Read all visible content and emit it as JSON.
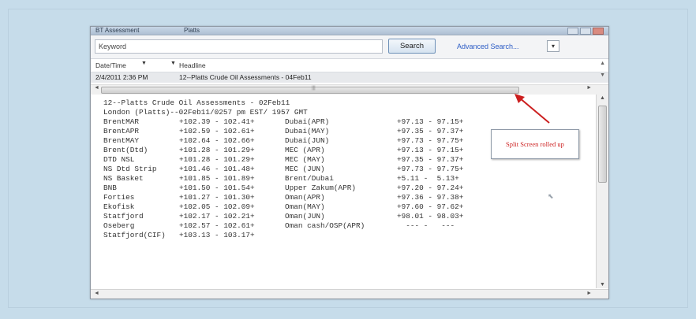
{
  "window": {
    "title_left": "BT Assessment",
    "title_mid": "Platts"
  },
  "search": {
    "keyword_placeholder": "Keyword",
    "search_label": "Search",
    "advanced_label": "Advanced Search...",
    "mini_label": "▾"
  },
  "list": {
    "col_date": "Date/Time",
    "col_headline": "Headline",
    "row_date": "2/4/2011 2:36 PM",
    "row_headline": "12--Platts Crude Oil Assessments - 04Feb11"
  },
  "story": {
    "line1": "12--Platts Crude Oil Assessments - 02Feb11",
    "line2": "London (Platts)--02Feb11/0257 pm EST/ 1957 GMT",
    "rows": [
      {
        "n1": "BrentMAR",
        "v1": "+102.39 - 102.41+",
        "n2": "Dubai(APR)",
        "v2": "+97.13 - 97.15+"
      },
      {
        "n1": "BrentAPR",
        "v1": "+102.59 - 102.61+",
        "n2": "Dubai(MAY)",
        "v2": "+97.35 - 97.37+"
      },
      {
        "n1": "BrentMAY",
        "v1": "+102.64 - 102.66+",
        "n2": "Dubai(JUN)",
        "v2": "+97.73 - 97.75+"
      },
      {
        "n1": "Brent(Dtd)",
        "v1": "+101.28 - 101.29+",
        "n2": "MEC (APR)",
        "v2": "+97.13 - 97.15+"
      },
      {
        "n1": "DTD NSL",
        "v1": "+101.28 - 101.29+",
        "n2": "MEC (MAY)",
        "v2": "+97.35 - 97.37+"
      },
      {
        "n1": "NS Dtd Strip",
        "v1": "+101.46 - 101.48+",
        "n2": "MEC (JUN)",
        "v2": "+97.73 - 97.75+"
      },
      {
        "n1": "NS Basket",
        "v1": "+101.85 - 101.89+",
        "n2": "Brent/Dubai",
        "v2": "+5.11 -  5.13+"
      },
      {
        "n1": "BNB",
        "v1": "+101.50 - 101.54+",
        "n2": "Upper Zakum(APR)",
        "v2": "+97.20 - 97.24+"
      },
      {
        "n1": "Forties",
        "v1": "+101.27 - 101.30+",
        "n2": "Oman(APR)",
        "v2": "+97.36 - 97.38+"
      },
      {
        "n1": "Ekofisk",
        "v1": "+102.05 - 102.09+",
        "n2": "Oman(MAY)",
        "v2": "+97.60 - 97.62+"
      },
      {
        "n1": "Statfjord",
        "v1": "+102.17 - 102.21+",
        "n2": "Oman(JUN)",
        "v2": "+98.01 - 98.03+"
      },
      {
        "n1": "Oseberg",
        "v1": "+102.57 - 102.61+",
        "n2": "Oman cash/OSP(APR)",
        "v2": "  --- -   ---"
      },
      {
        "n1": "Statfjord(CIF)",
        "v1": "+103.13 - 103.17+",
        "n2": "",
        "v2": ""
      }
    ]
  },
  "annotation": {
    "text": "Split Screen rolled up",
    "color": "#cc1f1f"
  }
}
